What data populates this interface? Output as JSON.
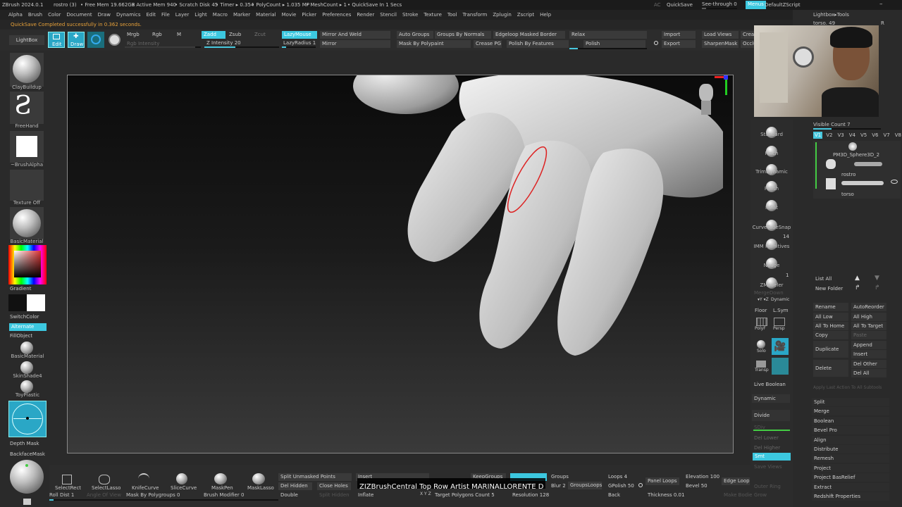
{
  "titlebar": {
    "app": "ZBrush 2024.0.1",
    "doc": "rostro (3)",
    "free_mem": "• Free Mem 19.662GB",
    "active_mem": "• Active Mem 940",
    "scratch": "• Scratch Disk 45",
    "timer": "• Timer ▸ 0.354",
    "polycount": "• PolyCount ▸ 1.035 MP",
    "meshcount": "• MeshCount ▸ 1",
    "quicksave": "• QuickSave In 1 Secs",
    "ac": "AC",
    "quicksave_btn": "QuickSave",
    "see_through": "See-through  0",
    "menu": "Menus",
    "script": "DefaultZScript"
  },
  "menubar": [
    "Alpha",
    "Brush",
    "Color",
    "Document",
    "Draw",
    "Dynamics",
    "Edit",
    "File",
    "Layer",
    "Light",
    "Macro",
    "Marker",
    "Material",
    "Movie",
    "Picker",
    "Preferences",
    "Render",
    "Stencil",
    "Stroke",
    "Texture",
    "Tool",
    "Transform",
    "Zplugin",
    "Zscript",
    "Help"
  ],
  "notice": "QuickSave Completed successfully in 0.362 seconds.",
  "toolbar": {
    "lightbox": "LightBox",
    "edit": "Edit",
    "draw": "Draw",
    "mrgb": "Mrgb",
    "rgb": "Rgb",
    "m": "M",
    "rgb_intensity": "Rgb Intensity",
    "zadd": "Zadd",
    "zsub": "Zsub",
    "zcut": "Zcut",
    "z_intensity": "Z Intensity 20",
    "lazymouse": "LazyMouse",
    "lazyradius": "LazyRadius 1",
    "mirror_weld": "Mirror And Weld",
    "mirror": "Mirror",
    "auto_groups": "Auto Groups",
    "groups_by_normals": "Groups By Normals",
    "mask_by_polypaint": "Mask By Polypaint",
    "crease_pg": "Crease PG",
    "edgeloop": "Edgeloop Masked Border",
    "polish_features": "Polish By Features",
    "relax": "Relax",
    "polish": "Polish",
    "import": "Import",
    "export": "Export",
    "load_views": "Load Views",
    "sharpenmask": "SharpenMask",
    "creas": "Creas",
    "occlu": "Occlu"
  },
  "left_shelf": {
    "brush1": "ClayBuildup",
    "brush2": "FreeHand",
    "alpha": "~BrushAlpha",
    "texture": "Texture Off",
    "material": "BasicMaterial",
    "gradient": "Gradient",
    "switchcolor": "SwitchColor",
    "alternate": "Alternate",
    "fillobject": "FillObject",
    "mat2": "BasicMaterial",
    "mat3": "SkinShade4",
    "mat4": "ToyPlastic",
    "depth_mask": "Depth Mask",
    "backface": "BackfaceMask"
  },
  "brush_column": {
    "items": [
      "Standard",
      "Pinch",
      "TrimDynamic",
      "Polish",
      "Inflat",
      "CurveTubeSnap",
      "IMM Primitives",
      "Nudge",
      "ZModeler"
    ],
    "imm_count": "14",
    "zmodeler_count": "1",
    "mergedown": "MergeDown",
    "dynamic": "Dynamic",
    "floor": "Floor",
    "lsym": "L.Sym",
    "polyf": "PolyF",
    "persp": "Persp",
    "solo": "Solo",
    "transp": "Transp",
    "xyz_hint": "▾Y ▾Z"
  },
  "right_mid": {
    "live_boolean": "Live Boolean",
    "dynamic": "Dynamic",
    "divide": "Divide",
    "sdiv": "SDiv",
    "del_lower": "Del Lower",
    "del_higher": "Del Higher",
    "smt": "Smt",
    "save_views": "Save Views",
    "outer_ring": "Outer Ring",
    "grow": "Grow"
  },
  "subtool": {
    "header": "Lightbox▸Tools",
    "tool_name": "torso. 49",
    "r_btn": "R",
    "visible_count": "Visible Count 7",
    "versions": [
      "V1",
      "V2",
      "V3",
      "V4",
      "V5",
      "V6",
      "V7",
      "V8"
    ],
    "items": [
      "PM3D_Sphere3D_2",
      "rostro",
      "torso"
    ],
    "list_all": "List All",
    "new_folder": "New Folder",
    "rename": "Rename",
    "autoreorder": "AutoReorder",
    "all_low": "All Low",
    "all_high": "All High",
    "all_to_home": "All To Home",
    "all_to_target": "All To Target",
    "copy": "Copy",
    "paste": "Paste",
    "duplicate": "Duplicate",
    "append": "Append",
    "insert": "Insert",
    "delete": "Delete",
    "del_other": "Del Other",
    "del_all": "Del All",
    "apply_last": "Apply Last Action To All Subtools",
    "tools": [
      "Split",
      "Merge",
      "Boolean",
      "Bevel Pro",
      "Align",
      "Distribute",
      "Remesh",
      "Project",
      "Project BasRelief",
      "Extract",
      "Redshift Properties"
    ]
  },
  "bottom": {
    "selectrect": "SelectRect",
    "selectlasso": "SelectLasso",
    "knifecurve": "KnifeCurve",
    "slicecurve": "SliceCurve",
    "maskpen": "MaskPen",
    "masklasso": "MaskLasso",
    "roll_dist": "Roll Dist 1",
    "angle_view": "Angle Of View",
    "mask_polygroups": "Mask By Polygroups 0",
    "brush_modifier": "Brush Modifier 0",
    "split_unmasked": "Split Unmasked Points",
    "del_hidden": "Del Hidden",
    "close_holes": "Close Holes",
    "double": "Double",
    "split_hidden": "Split Hidden",
    "insert": "Insert",
    "inflate": "Inflate",
    "keepgroups": "KeepGroups",
    "target_poly": "Target Polygons Count 5",
    "resolution": "Resolution 128",
    "groups": "Groups",
    "blur": "Blur 2",
    "groupsloops": "GroupsLoops",
    "loops": "Loops 4",
    "gpolish": "GPolish 50",
    "back": "Back",
    "panel_loops": "Panel Loops",
    "thickness": "Thickness 0.01",
    "elevation": "Elevation 100",
    "bevel": "Bevel 50",
    "edge_loop": "Edge Loop",
    "make_bodie": "Make Bodie",
    "xyz": "X Y Z",
    "caption": "ZIZBrushCentral Top Row Artist MARINALLORENTE D"
  },
  "colors": {
    "accent": "#3cc8e0",
    "panel": "#2c2c2c",
    "viewport_top": "#111111",
    "viewport_bottom": "#3a3a3a"
  }
}
